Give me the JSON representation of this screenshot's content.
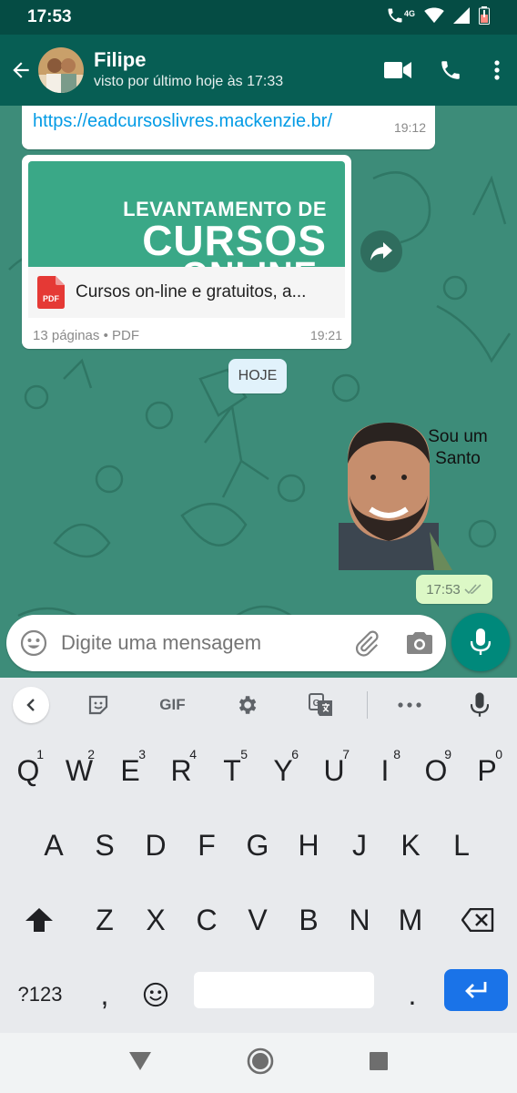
{
  "status_bar": {
    "time": "17:53",
    "network": "4G"
  },
  "header": {
    "contact_name": "Filipe",
    "contact_status": "visto por último hoje às 17:33"
  },
  "messages": {
    "link": {
      "url": "https://eadcursoslivres.mackenzie.br/",
      "time": "19:12"
    },
    "document": {
      "preview_line1": "LEVANTAMENTO DE",
      "preview_line2": "CURSOS",
      "preview_line3": "ONLINE",
      "file_type": "PDF",
      "file_name": "Cursos on-line e gratuitos, a...",
      "meta": "13 páginas • PDF",
      "time": "19:21"
    },
    "date_divider": "HOJE",
    "sticker": {
      "caption_line1": "Sou um",
      "caption_line2": "Santo"
    },
    "outgoing_time": "17:53"
  },
  "input": {
    "placeholder": "Digite uma mensagem"
  },
  "keyboard": {
    "toolbar_gif": "GIF",
    "row1": [
      {
        "key": "Q",
        "hint": "1"
      },
      {
        "key": "W",
        "hint": "2"
      },
      {
        "key": "E",
        "hint": "3"
      },
      {
        "key": "R",
        "hint": "4"
      },
      {
        "key": "T",
        "hint": "5"
      },
      {
        "key": "Y",
        "hint": "6"
      },
      {
        "key": "U",
        "hint": "7"
      },
      {
        "key": "I",
        "hint": "8"
      },
      {
        "key": "O",
        "hint": "9"
      },
      {
        "key": "P",
        "hint": "0"
      }
    ],
    "row2": [
      "A",
      "S",
      "D",
      "F",
      "G",
      "H",
      "J",
      "K",
      "L"
    ],
    "row3": [
      "Z",
      "X",
      "C",
      "V",
      "B",
      "N",
      "M"
    ],
    "symbols_key": "?123",
    "comma_key": ",",
    "period_key": "."
  },
  "colors": {
    "header": "#075e54",
    "status_bar": "#054c44",
    "chat_bg": "#3d8c79",
    "accent": "#00897b",
    "outgoing_bubble": "#dcf8c6",
    "enter_key": "#1a73e8"
  }
}
